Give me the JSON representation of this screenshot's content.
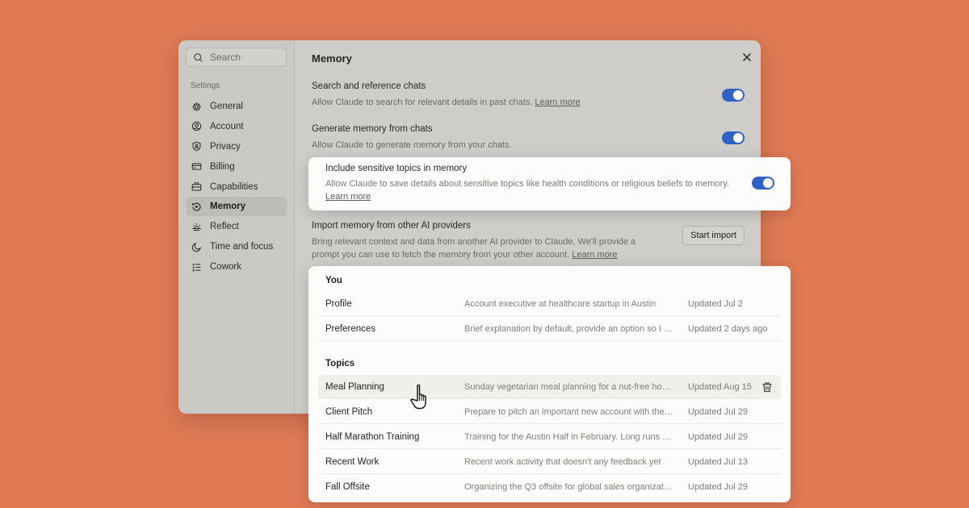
{
  "sidebar": {
    "search_placeholder": "Search",
    "heading": "Settings",
    "items": [
      {
        "label": "General",
        "icon": "gear-icon"
      },
      {
        "label": "Account",
        "icon": "user-circle-icon"
      },
      {
        "label": "Privacy",
        "icon": "shield-icon"
      },
      {
        "label": "Billing",
        "icon": "credit-card-icon"
      },
      {
        "label": "Capabilities",
        "icon": "briefcase-icon"
      },
      {
        "label": "Memory",
        "icon": "memory-icon",
        "active": true
      },
      {
        "label": "Reflect",
        "icon": "sunrise-icon"
      },
      {
        "label": "Time and focus",
        "icon": "moon-icon"
      },
      {
        "label": "Cowork",
        "icon": "list-check-icon"
      }
    ]
  },
  "main": {
    "title": "Memory",
    "settings": [
      {
        "title": "Search and reference chats",
        "desc": "Allow Claude to search for relevant details in past chats.",
        "link": "Learn more",
        "toggle": true
      },
      {
        "title": "Generate memory from chats",
        "desc": "Allow Claude to generate memory from your chats.",
        "toggle": true
      },
      {
        "title": "Include sensitive topics in memory",
        "desc": "Allow Claude to save details about sensitive topics like health conditions or religious beliefs to memory.",
        "link": "Learn more",
        "toggle": true
      },
      {
        "title": "Import memory from other AI providers",
        "desc": "Bring relevant context and data from another AI provider to Claude. We'll provide a prompt you can use to fetch the memory from your other account.",
        "link": "Learn more",
        "button": "Start import"
      }
    ]
  },
  "memory_list": {
    "you_heading": "You",
    "you": [
      {
        "name": "Profile",
        "detail": "Account executive  at healthcare startup in Austin",
        "updated": "Updated Jul 2"
      },
      {
        "name": "Preferences",
        "detail": "Brief explanation by default, provide an option so I can ask more",
        "updated": "Updated 2 days ago"
      }
    ],
    "topics_heading": "Topics",
    "topics": [
      {
        "name": "Meal Planning",
        "detail": "Sunday vegetarian meal planning for a nut-free household",
        "updated": "Updated Aug 15"
      },
      {
        "name": "Client Pitch",
        "detail": "Prepare to pitch an important new account with the team",
        "updated": "Updated Jul 29"
      },
      {
        "name": "Half Marathon Training",
        "detail": "Training for the Austin Half in February. Long runs on weekends",
        "updated": "Updated Jul 29"
      },
      {
        "name": "Recent Work",
        "detail": "Recent work activity that doesn't any feedback yet",
        "updated": "Updated Jul 13"
      },
      {
        "name": "Fall Offsite",
        "detail": "Organizing the Q3 offsite for global sales organization",
        "updated": "Updated Jul 29"
      }
    ]
  },
  "colors": {
    "background": "#df7a55",
    "toggle_on": "#2f62c4"
  }
}
